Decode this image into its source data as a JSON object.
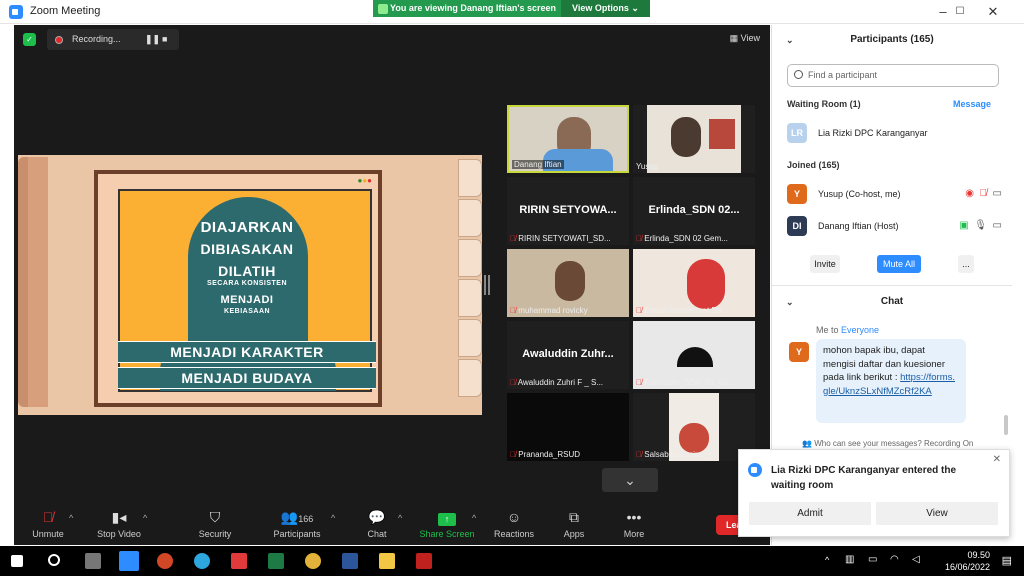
{
  "window": {
    "title": "Zoom Meeting",
    "min": "–",
    "max": "☐",
    "close": "✕"
  },
  "banner": {
    "viewing": "You are viewing Danang Iftian's screen",
    "options": "View Options ⌄"
  },
  "recording": {
    "label": "Recording...",
    "pause": "❚❚",
    "stop": "■"
  },
  "view_label": "View",
  "presentation": {
    "lines": [
      "DIAJARKAN",
      "DIBIASAKAN",
      "DILATIH",
      "SECARA KONSISTEN",
      "MENJADI",
      "KEBIASAAN",
      "MENJADI KARAKTER",
      "MENJADI BUDAYA"
    ]
  },
  "tiles": [
    {
      "name": "Danang Iftian",
      "big": "",
      "active": true
    },
    {
      "name": "Yusup",
      "big": "",
      "active": false
    },
    {
      "name": "RIRIN SETYOWATI_SD...",
      "big": "RIRIN SETYOWA...",
      "active": false
    },
    {
      "name": "Erlinda_SDN 02 Gem...",
      "big": "Erlinda_SDN 02...",
      "active": false
    },
    {
      "name": "muhammad rovicky",
      "big": "",
      "active": false
    },
    {
      "name": "Endah Inspektorat Da...",
      "big": "",
      "active": false
    },
    {
      "name": "Awaluddin Zuhri F _ S...",
      "big": "Awaluddin Zuhr...",
      "active": false
    },
    {
      "name": "Fakhrudin_SDN_01_Gi...",
      "big": "",
      "active": false
    },
    {
      "name": "Prananda_RSUD",
      "big": "",
      "active": false
    },
    {
      "name": "Salsabila Banina R",
      "big": "",
      "active": false
    }
  ],
  "toolbar": {
    "unmute": "Unmute",
    "stop_video": "Stop Video",
    "security": "Security",
    "participants": "Participants",
    "participants_count": "166",
    "chat": "Chat",
    "share": "Share Screen",
    "reactions": "Reactions",
    "apps": "Apps",
    "more": "More",
    "leave": "Lea"
  },
  "panel": {
    "participants_title": "Participants (165)",
    "search_placeholder": "Find a participant",
    "waiting_room": "Waiting Room (1)",
    "message": "Message",
    "waiting": [
      {
        "initials": "LR",
        "name": "Lia Rizki DPC Karanganyar"
      }
    ],
    "joined": "Joined (165)",
    "participants": [
      {
        "initials": "Y",
        "name": "Yusup (Co-host, me)",
        "color": "#e06a1b"
      },
      {
        "initials": "DI",
        "name": "Danang Iftian (Host)",
        "color": "#2d3b55"
      }
    ],
    "invite": "Invite",
    "mute_all": "Mute All",
    "more": "...",
    "chat_title": "Chat",
    "chat_to": "Me to",
    "chat_everyone": "Everyone",
    "chat_avatar": "Y",
    "chat_message": "mohon bapak ibu, dapat mengisi daftar dan kuesioner pada link berikut :",
    "chat_link": "https://forms.gle/UknzSLxNfMZcRf2KA",
    "who_see": "Who can see your messages? Recording On"
  },
  "notification": {
    "text": "Lia Rizki DPC Karanganyar entered the waiting room",
    "admit": "Admit",
    "view": "View",
    "close": "✕"
  },
  "taskbar": {
    "time": "09.50",
    "date": "16/06/2022"
  },
  "colors": {
    "zoom_blue": "#2d8cff",
    "banner_green": "#249a4e",
    "leave_red": "#e02828",
    "slide_teal": "#2d6a6e",
    "slide_orange": "#fbb034"
  }
}
